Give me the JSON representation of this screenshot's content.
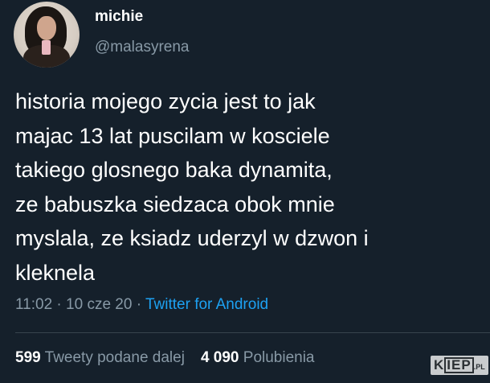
{
  "author": {
    "display_name": "michie",
    "handle": "@malasyrena"
  },
  "tweet": {
    "lines": [
      "historia mojego zycia jest to jak",
      "majac 13 lat puscilam w kosciele",
      "takiego glosnego baka dynamita,",
      "ze babuszka siedzaca obok mnie",
      "myslala, ze ksiadz uderzyl w dzwon i",
      "kleknela"
    ],
    "time": "11:02",
    "separator": "·",
    "date": "10 cze 20",
    "source": "Twitter for Android"
  },
  "stats": {
    "retweets_count": "599",
    "retweets_label": "Tweety podane dalej",
    "likes_count": "4 090",
    "likes_label": "Polubienia"
  },
  "watermark": {
    "text_left": "K",
    "text_box": "IEP",
    "text_suffix": ".PL"
  },
  "colors": {
    "background": "#15202b",
    "secondary_text": "#8899a6",
    "link": "#1da1f2"
  }
}
